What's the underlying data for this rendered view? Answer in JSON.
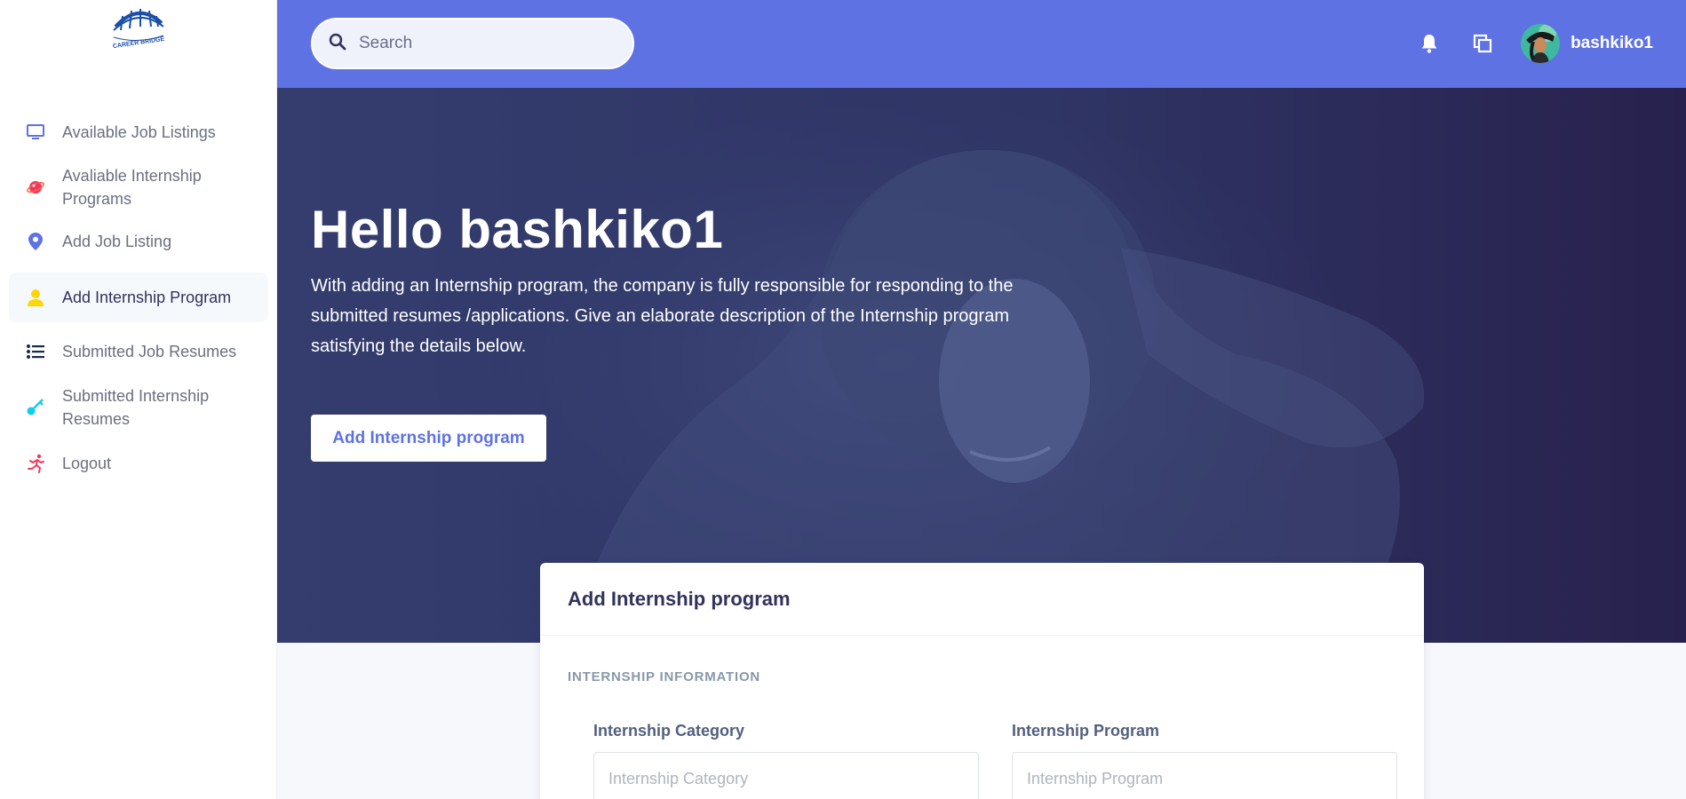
{
  "app": {
    "logo_text": "CAREER BRIDGE"
  },
  "sidebar": {
    "items": [
      {
        "label": "Available Job Listings",
        "icon": "monitor-icon",
        "color": "#5e72e4"
      },
      {
        "label": "Avaliable Internship Programs",
        "icon": "planet-icon",
        "color": "#f5365c"
      },
      {
        "label": "Add Job Listing",
        "icon": "map-pin-icon",
        "color": "#5e72e4"
      },
      {
        "label": "Add Internship Program",
        "icon": "user-icon",
        "color": "#ffd600",
        "active": true
      },
      {
        "label": "Submitted Job Resumes",
        "icon": "bullet-list-icon",
        "color": "#172b4d"
      },
      {
        "label": "Submitted Internship Resumes",
        "icon": "key-icon",
        "color": "#11cdef"
      },
      {
        "label": "Logout",
        "icon": "running-icon",
        "color": "#f5365c"
      }
    ]
  },
  "topbar": {
    "search_placeholder": "Search",
    "username": "bashkiko1",
    "icons": [
      "bell-icon",
      "pages-icon"
    ],
    "background": "#5e72e4"
  },
  "hero": {
    "title": "Hello bashkiko1",
    "description": "With adding an Internship program, the company is fully responsible for responding to the submitted resumes /applications. Give an elaborate description of the Internship program satisfying the details below.",
    "button_label": "Add Internship program"
  },
  "form": {
    "title": "Add Internship program",
    "section_title": "INTERNSHIP INFORMATION",
    "fields": [
      {
        "label": "Internship Category",
        "placeholder": "Internship Category"
      },
      {
        "label": "Internship Program",
        "placeholder": "Internship Program"
      }
    ]
  }
}
